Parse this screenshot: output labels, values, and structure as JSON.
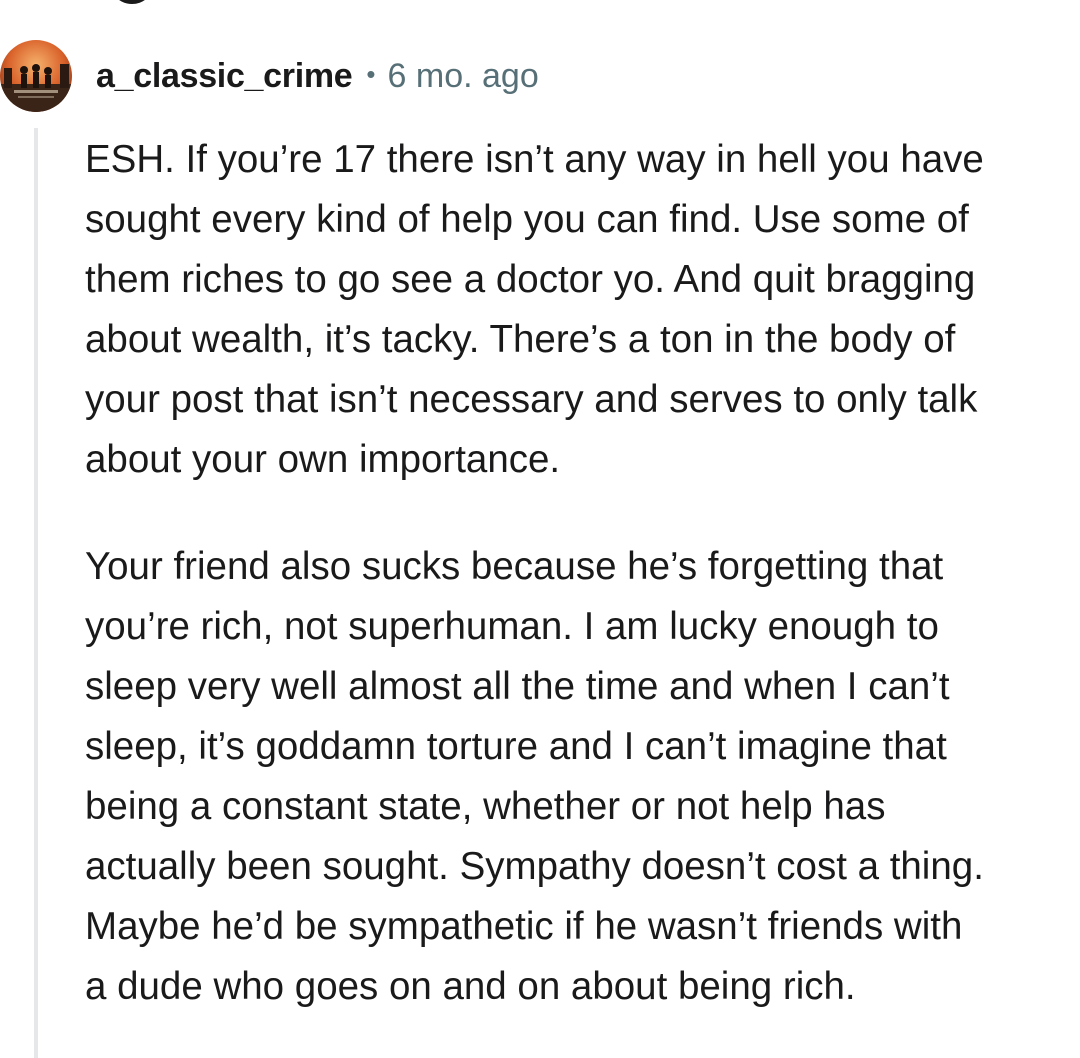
{
  "comment": {
    "username": "a_classic_crime",
    "separator": "•",
    "timestamp": "6 mo. ago",
    "avatar_icon": "user-avatar-icon",
    "paragraphs": [
      {
        "lines": [
          "ESH. If you’re 17 there isn’t any way in hell you have",
          "sought every kind of help you can find. Use some of",
          "them riches to go see a doctor yo. And quit bragging",
          "about wealth, it’s tacky. There’s a ton in the body of",
          "your post that isn’t necessary and serves to only talk",
          "about your own importance."
        ]
      },
      {
        "lines": [
          "Your friend also sucks because he’s forgetting that",
          "you’re rich, not superhuman. I am lucky enough to",
          "sleep very well almost all the time and when I can’t",
          "sleep, it’s goddamn torture and I can’t imagine that",
          "being a constant state, whether or not help has",
          "actually been sought. Sympathy doesn’t cost a thing.",
          "Maybe he’d be sympathetic if he wasn’t friends with",
          "a dude who goes on and on about being rich."
        ]
      }
    ]
  },
  "colors": {
    "text": "#1a1a1b",
    "meta": "#576f76",
    "thread_line": "#e5e7e8",
    "background": "#ffffff"
  }
}
